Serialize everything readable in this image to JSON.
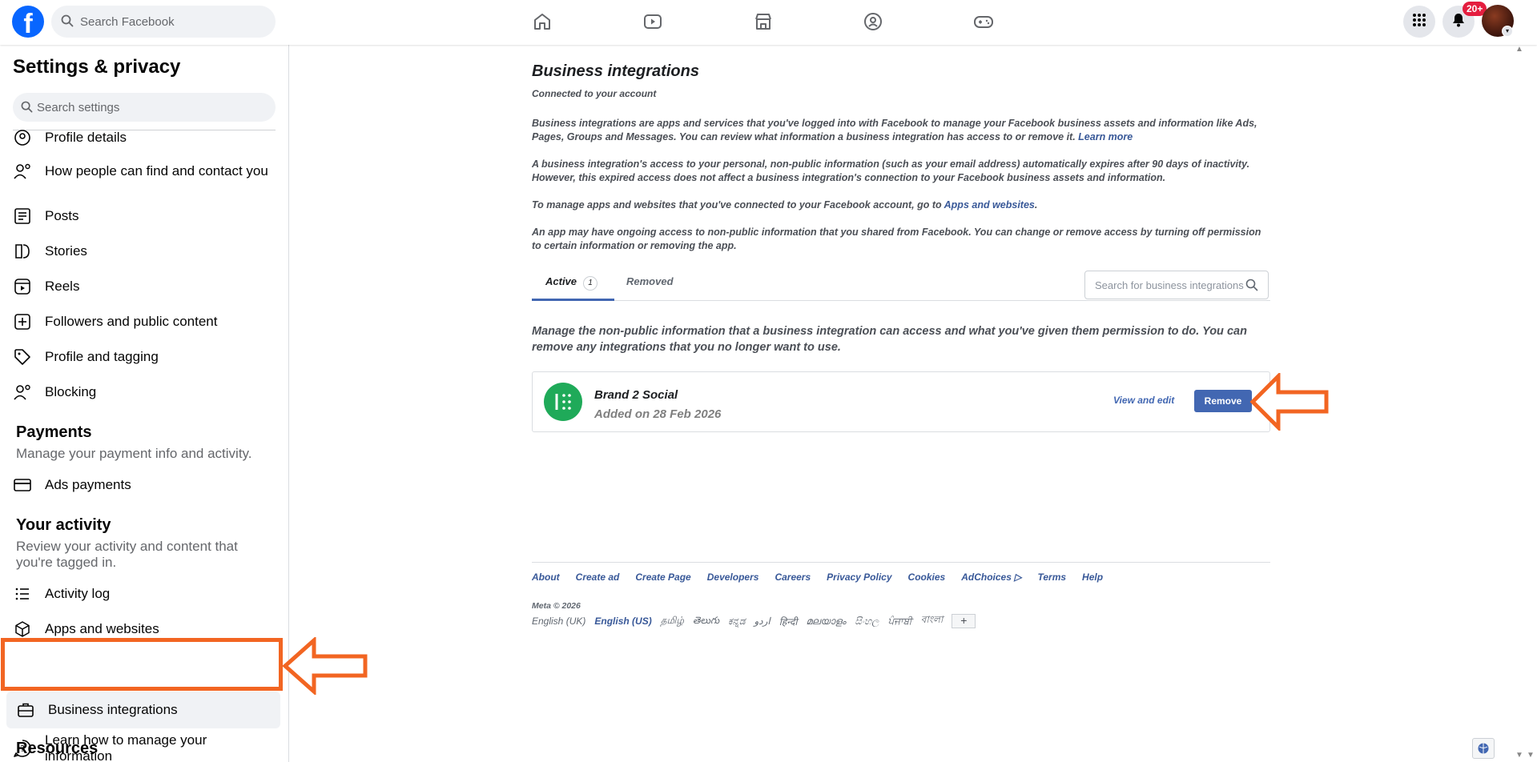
{
  "topbar": {
    "logo": "f",
    "search_placeholder": "Search Facebook",
    "nav_icons": [
      "home-icon",
      "video-icon",
      "marketplace-icon",
      "groups-icon",
      "gaming-icon"
    ],
    "notification_badge": "20+"
  },
  "sidebar": {
    "title": "Settings & privacy",
    "search_placeholder": "Search settings",
    "items": [
      {
        "label": "Profile details",
        "icon": "user-icon"
      },
      {
        "label": "How people can find and contact you",
        "icon": "people-search-icon"
      },
      {
        "label": "Posts",
        "icon": "posts-icon"
      },
      {
        "label": "Stories",
        "icon": "stories-icon"
      },
      {
        "label": "Reels",
        "icon": "reels-icon"
      },
      {
        "label": "Followers and public content",
        "icon": "plus-square-icon"
      },
      {
        "label": "Profile and tagging",
        "icon": "tag-icon"
      },
      {
        "label": "Blocking",
        "icon": "blocking-icon"
      }
    ],
    "payments": {
      "heading": "Payments",
      "subtitle": "Manage your payment info and activity.",
      "items": [
        {
          "label": "Ads payments",
          "icon": "card-icon"
        }
      ]
    },
    "activity": {
      "heading": "Your activity",
      "subtitle": "Review your activity and content that you're tagged in.",
      "items": [
        {
          "label": "Activity log",
          "icon": "list-icon"
        },
        {
          "label": "Apps and websites",
          "icon": "cube-icon"
        },
        {
          "label": "Business integrations",
          "icon": "briefcase-icon"
        },
        {
          "label": "Learn how to manage your information",
          "icon": "help-icon"
        }
      ]
    },
    "resources": {
      "heading": "Resources"
    }
  },
  "main": {
    "title": "Business integrations",
    "subtitle": "Connected to your account",
    "para1": "Business integrations are apps and services that you've logged into with Facebook to manage your Facebook business assets and information like Ads, Pages, Groups and Messages. You can review what information a business integration has access to or remove it.",
    "para1_link": "Learn more",
    "para2": "A business integration's access to your personal, non-public information (such as your email address) automatically expires after 90 days of inactivity. However, this expired access does not affect a business integration's connection to your Facebook business assets and information.",
    "para3_prefix": "To manage apps and websites that you've connected to your Facebook account, go to",
    "para3_link": "Apps and websites",
    "para3_suffix": ".",
    "para4": "An app may have ongoing access to non-public information that you shared from Facebook. You can change or remove access by turning off permission to certain information or removing the app.",
    "tabs": {
      "active_label": "Active",
      "active_count": "1",
      "removed_label": "Removed",
      "search_placeholder": "Search for business integrations"
    },
    "manage_text": "Manage the non-public information that a business integration can access and what you've given them permission to do. You can remove any integrations that you no longer want to use.",
    "integration": {
      "name": "Brand 2 Social",
      "added": "Added on 28 Feb 2026",
      "view_edit": "View and edit",
      "remove": "Remove"
    }
  },
  "footer": {
    "links": [
      "About",
      "Create ad",
      "Create Page",
      "Developers",
      "Careers",
      "Privacy Policy",
      "Cookies",
      "AdChoices",
      "Terms",
      "Help"
    ],
    "copyright": "Meta © 2026",
    "languages": [
      "English (UK)",
      "English (US)",
      "தமிழ்",
      "తెలుగు",
      "ಕನ್ನಡ",
      "اردو",
      "हिन्दी",
      "മലയാളം",
      "සිංහල",
      "ਪੰਜਾਬੀ",
      "বাংলা"
    ],
    "more_languages": "+"
  },
  "colors": {
    "brand": "#0866ff",
    "link": "#385898",
    "button": "#4267b2",
    "annotation": "#f26522",
    "app_logo": "#1faa59"
  }
}
